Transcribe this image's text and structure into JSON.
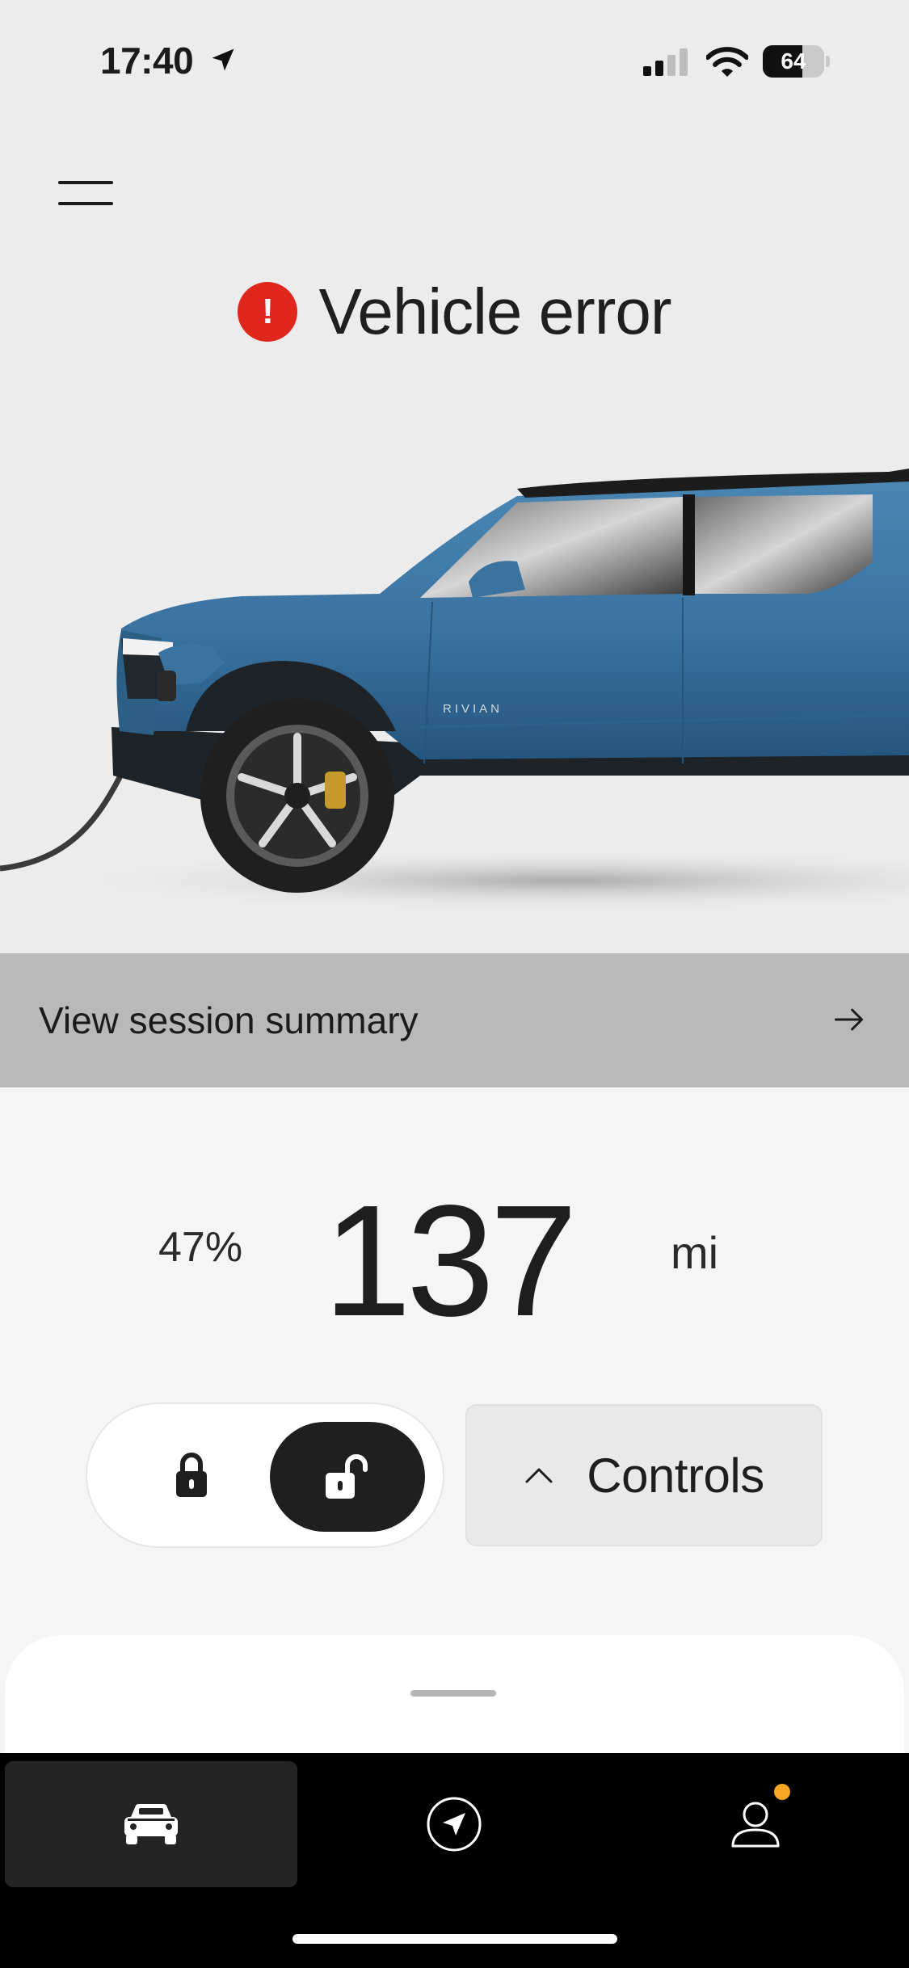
{
  "status_bar": {
    "time": "17:40",
    "battery": "64",
    "battery_level": 0.64
  },
  "header": {
    "menu_icon": "hamburger-menu-icon"
  },
  "alert": {
    "icon": "error-exclamation-icon",
    "glyph": "!",
    "title": "Vehicle error"
  },
  "vehicle": {
    "badge": "RIVIAN",
    "body_color": "#3f78a3"
  },
  "session": {
    "label": "View session summary",
    "arrow_icon": "arrow-right-icon"
  },
  "range": {
    "battery_percent": "47%",
    "value": "137",
    "unit": "mi"
  },
  "controls": {
    "lock_icon": "lock-closed-icon",
    "unlock_icon": "lock-open-icon",
    "controls_label": "Controls",
    "chevron_icon": "chevron-up-icon"
  },
  "tabs": [
    {
      "name": "vehicle",
      "icon": "car-icon",
      "active": true
    },
    {
      "name": "navigation",
      "icon": "navigation-arrow-icon",
      "active": false
    },
    {
      "name": "profile",
      "icon": "person-icon",
      "active": false,
      "notification": true
    }
  ],
  "colors": {
    "error": "#e0271e",
    "notification": "#f5a623",
    "accent_dark": "#1f1f1f"
  }
}
